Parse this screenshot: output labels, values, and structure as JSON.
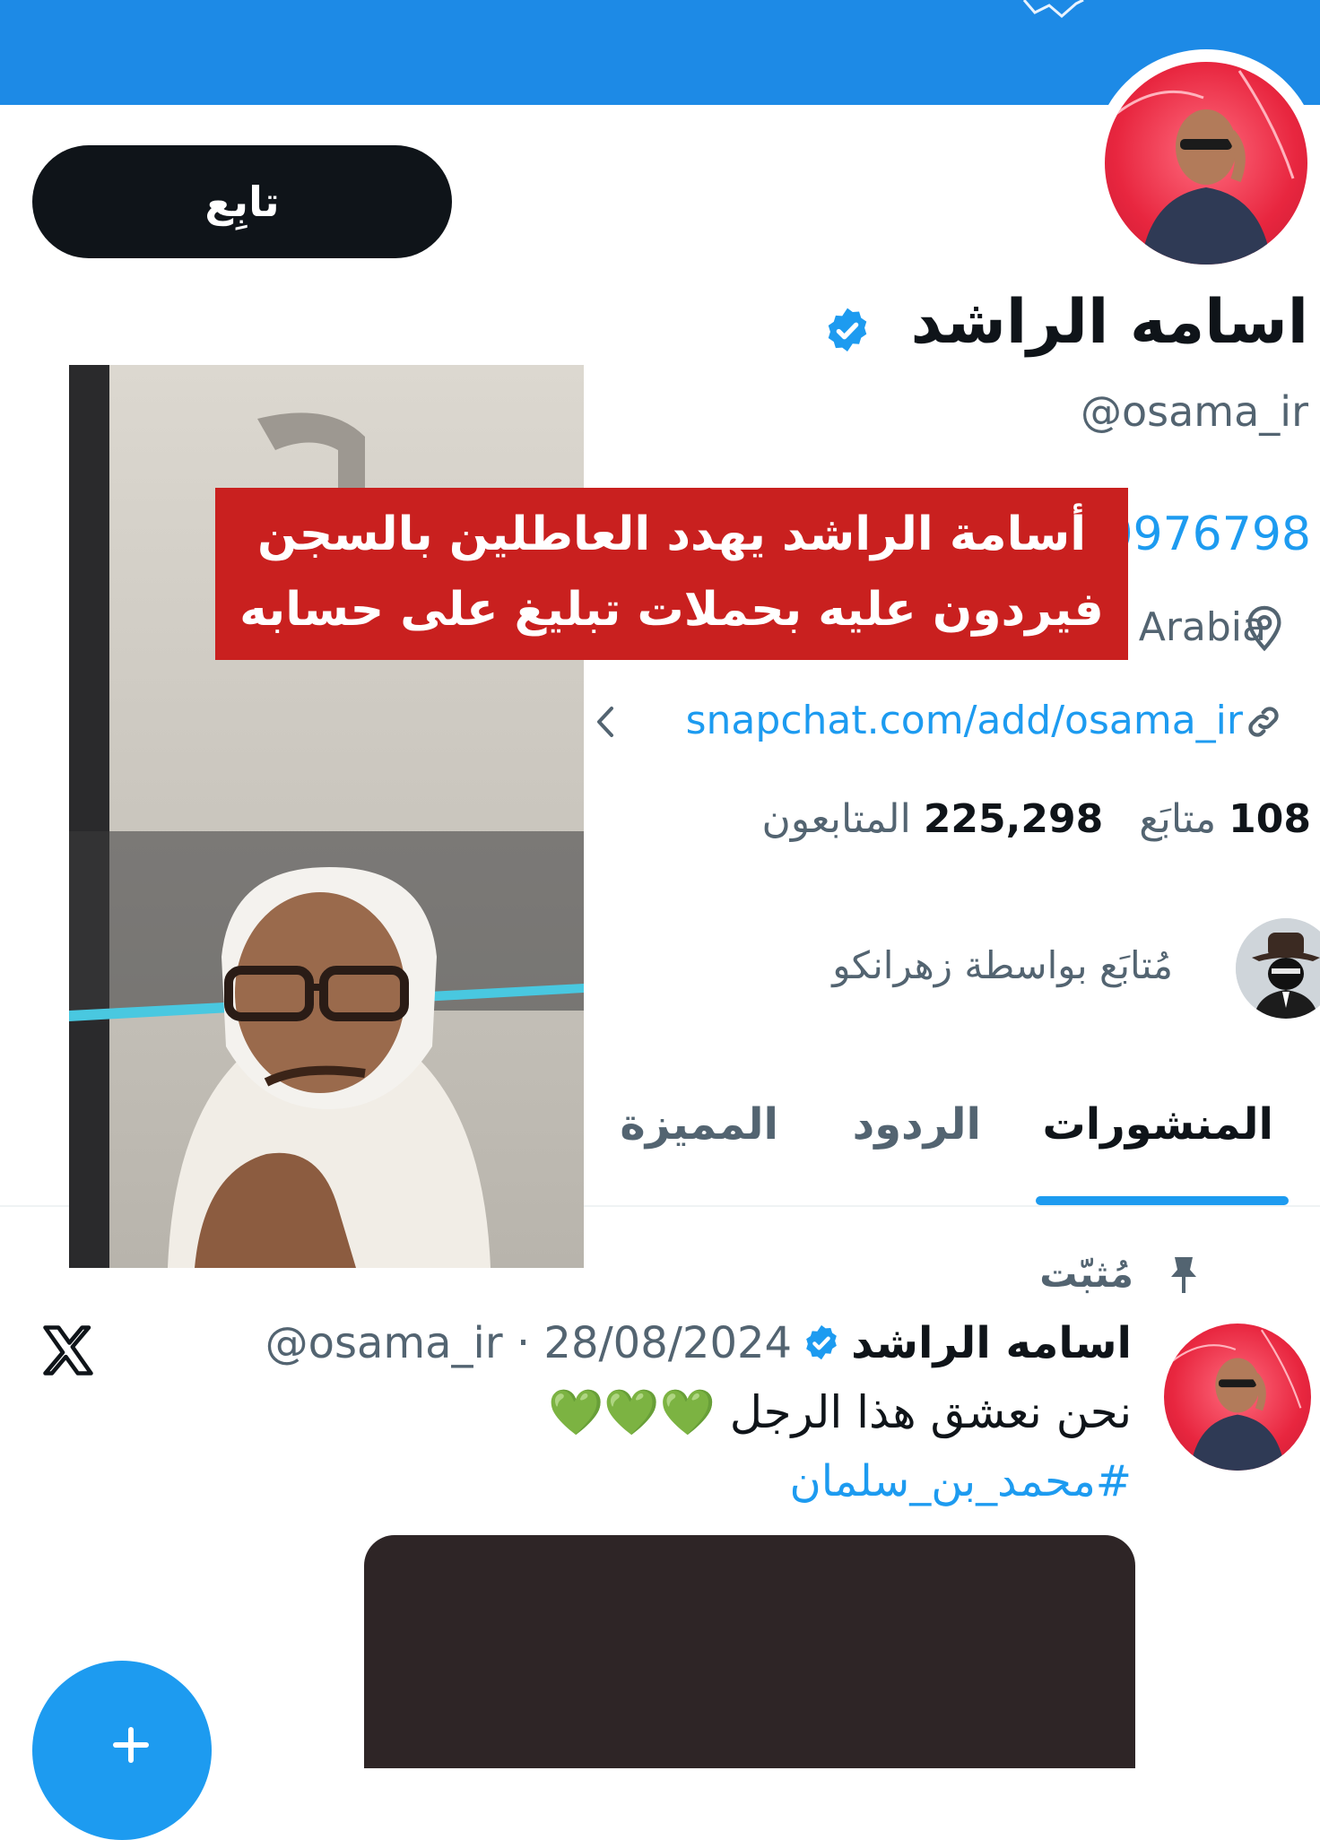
{
  "profile": {
    "name": "اسامه الراشد",
    "handle": "@osama_ir",
    "follow_label": "تابِع",
    "partial_phone": "0976798",
    "location": "Arabia",
    "link": "snapchat.com/add/osama_ir",
    "following_count": "108",
    "following_label": "متابَع",
    "followers_count": "225,298",
    "followers_label": "المتابعون",
    "followed_by": "مُتابَع بواسطة زهرانكو"
  },
  "tabs": {
    "posts": "المنشورات",
    "replies": "الردود",
    "featured": "المميزة"
  },
  "pinned": {
    "label": "مُثبّت",
    "author": "اسامه الراشد",
    "meta": "@osama_ir · 28/08/2024",
    "text": "نحن نعشق هذا الرجل",
    "hearts": "💚💚💚",
    "hashtag": "#محمد_بن_سلمان"
  },
  "overlay": {
    "caption_line1": "أسامة الراشد يهدد العاطلين بالسجن",
    "caption_line2": "فيردون عليه بحملات تبليغ على حسابه"
  },
  "colors": {
    "banner": "#1d8ae6",
    "accent": "#1d9bf0",
    "caption_bg": "#c9201f",
    "avatar_bg": "#e8263f"
  },
  "icons": [
    "verified-badge-icon",
    "location-pin-icon",
    "link-icon",
    "chevron-left-icon",
    "pin-icon",
    "x-logo-icon",
    "plus-icon"
  ]
}
